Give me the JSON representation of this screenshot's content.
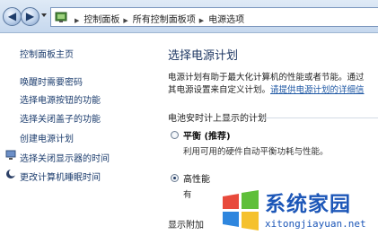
{
  "breadcrumb": {
    "segments": [
      "控制面板",
      "所有控制面板项",
      "电源选项"
    ],
    "separator": "▶"
  },
  "left_nav": {
    "home": "控制面板主页",
    "links": [
      "唤醒时需要密码",
      "选择电源按钮的功能",
      "选择关闭盖子的功能",
      "创建电源计划",
      "选择关闭显示器的时间",
      "更改计算机睡眠时间"
    ]
  },
  "main": {
    "title": "选择电源计划",
    "desc_line1": "电源计划有助于最大化计算机的性能或者节能。通过",
    "desc_line2_prefix": "其电源设置来自定义计划。",
    "desc_link": "请提供电源计划的详细信",
    "section_header": "电池安时计上显示的计划",
    "plans": [
      {
        "name": "平衡 (推荐)",
        "desc": "利用可用的硬件自动平衡功耗与性能。",
        "selected": false
      },
      {
        "name": "高性能",
        "desc": "有",
        "selected": true
      }
    ],
    "more": "显示附加"
  },
  "watermark": {
    "title": "系统家园",
    "url": "xitongjiayuan.net"
  },
  "colors": {
    "link": "#1c3d6e",
    "title": "#1e3763",
    "watermark": "#1d57b8"
  }
}
